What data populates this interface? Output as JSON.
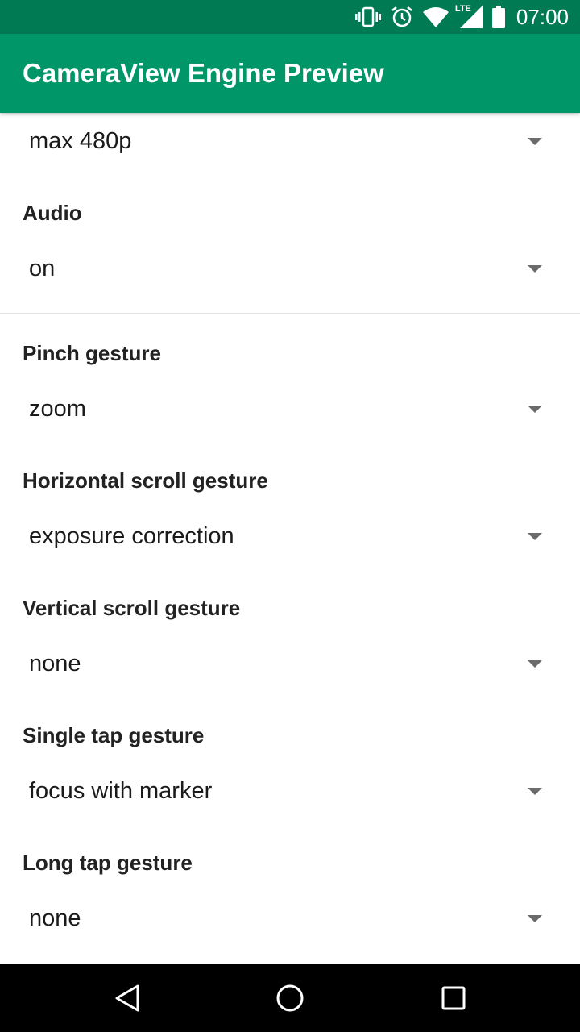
{
  "status_bar": {
    "time": "07:00",
    "icons": [
      "vibrate-icon",
      "alarm-icon",
      "wifi-icon",
      "lte-signal-icon",
      "battery-icon"
    ],
    "lte_label": "LTE",
    "background": "#007a53"
  },
  "app_bar": {
    "title": "CameraView Engine Preview",
    "background": "#009668"
  },
  "settings": {
    "video_size_value": "max 480p",
    "audio": {
      "label": "Audio",
      "value": "on"
    },
    "pinch": {
      "label": "Pinch gesture",
      "value": "zoom"
    },
    "horizontal_scroll": {
      "label": "Horizontal scroll gesture",
      "value": "exposure correction"
    },
    "vertical_scroll": {
      "label": "Vertical scroll gesture",
      "value": "none"
    },
    "single_tap": {
      "label": "Single tap gesture",
      "value": "focus with marker"
    },
    "long_tap": {
      "label": "Long tap gesture",
      "value": "none"
    }
  },
  "nav_bar": {
    "buttons": [
      "back-icon",
      "home-icon",
      "recents-icon"
    ]
  }
}
